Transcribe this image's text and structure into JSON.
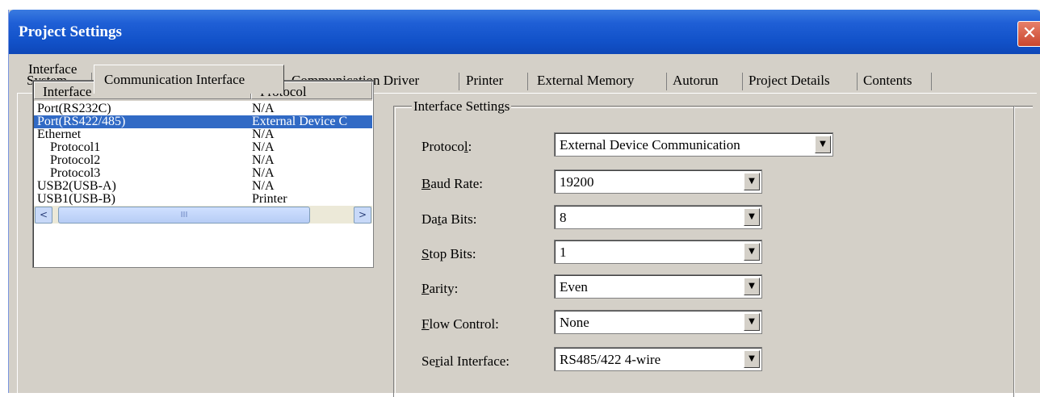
{
  "window": {
    "title": "Project Settings"
  },
  "tabs": [
    {
      "label": "System"
    },
    {
      "label": "Communication Interface",
      "active": true
    },
    {
      "label": "Communication Driver"
    },
    {
      "label": "Printer"
    },
    {
      "label": "External Memory"
    },
    {
      "label": "Autorun"
    },
    {
      "label": "Project Details"
    },
    {
      "label": "Contents"
    }
  ],
  "interface_panel": {
    "label": "Interface",
    "columns": [
      "Interface",
      "Protocol"
    ],
    "rows": [
      {
        "interface": "Port(RS232C)",
        "protocol": "N/A",
        "selected": false
      },
      {
        "interface": "Port(RS422/485)",
        "protocol": "External Device C",
        "selected": true
      },
      {
        "interface": "Ethernet",
        "protocol": "N/A",
        "selected": false
      },
      {
        "interface": "Protocol1",
        "protocol": "N/A",
        "selected": false
      },
      {
        "interface": "Protocol2",
        "protocol": "N/A",
        "selected": false
      },
      {
        "interface": "Protocol3",
        "protocol": "N/A",
        "selected": false
      },
      {
        "interface": "USB2(USB-A)",
        "protocol": "N/A",
        "selected": false
      },
      {
        "interface": "USB1(USB-B)",
        "protocol": "Printer",
        "selected": false
      }
    ],
    "scroll_left": "<",
    "scroll_right": ">",
    "scroll_grip": "III"
  },
  "settings": {
    "group_title": "Interface Settings",
    "protocol": {
      "label_pre": "Protoco",
      "label_u": "l",
      "label_post": ":",
      "value": "External Device Communication"
    },
    "baud_rate": {
      "label_pre": "",
      "label_u": "B",
      "label_post": "aud Rate:",
      "value": "19200"
    },
    "data_bits": {
      "label_pre": "Da",
      "label_u": "t",
      "label_post": "a Bits:",
      "value": "8"
    },
    "stop_bits": {
      "label_pre": "",
      "label_u": "S",
      "label_post": "top Bits:",
      "value": "1"
    },
    "parity": {
      "label_pre": "",
      "label_u": "P",
      "label_post": "arity:",
      "value": "Even"
    },
    "flow_control": {
      "label_pre": "",
      "label_u": "F",
      "label_post": "low Control:",
      "value": "None"
    },
    "serial_interface": {
      "label_pre": "Se",
      "label_u": "r",
      "label_post": "ial Interface:",
      "value": "RS485/422 4-wire"
    },
    "dropdown_glyph": "▼"
  },
  "icons": {
    "close": "close-icon"
  },
  "colors": {
    "titlebar": "#1252c9",
    "selection": "#316ac5",
    "dialog_bg": "#d4d0c8",
    "close": "#c8462e"
  }
}
